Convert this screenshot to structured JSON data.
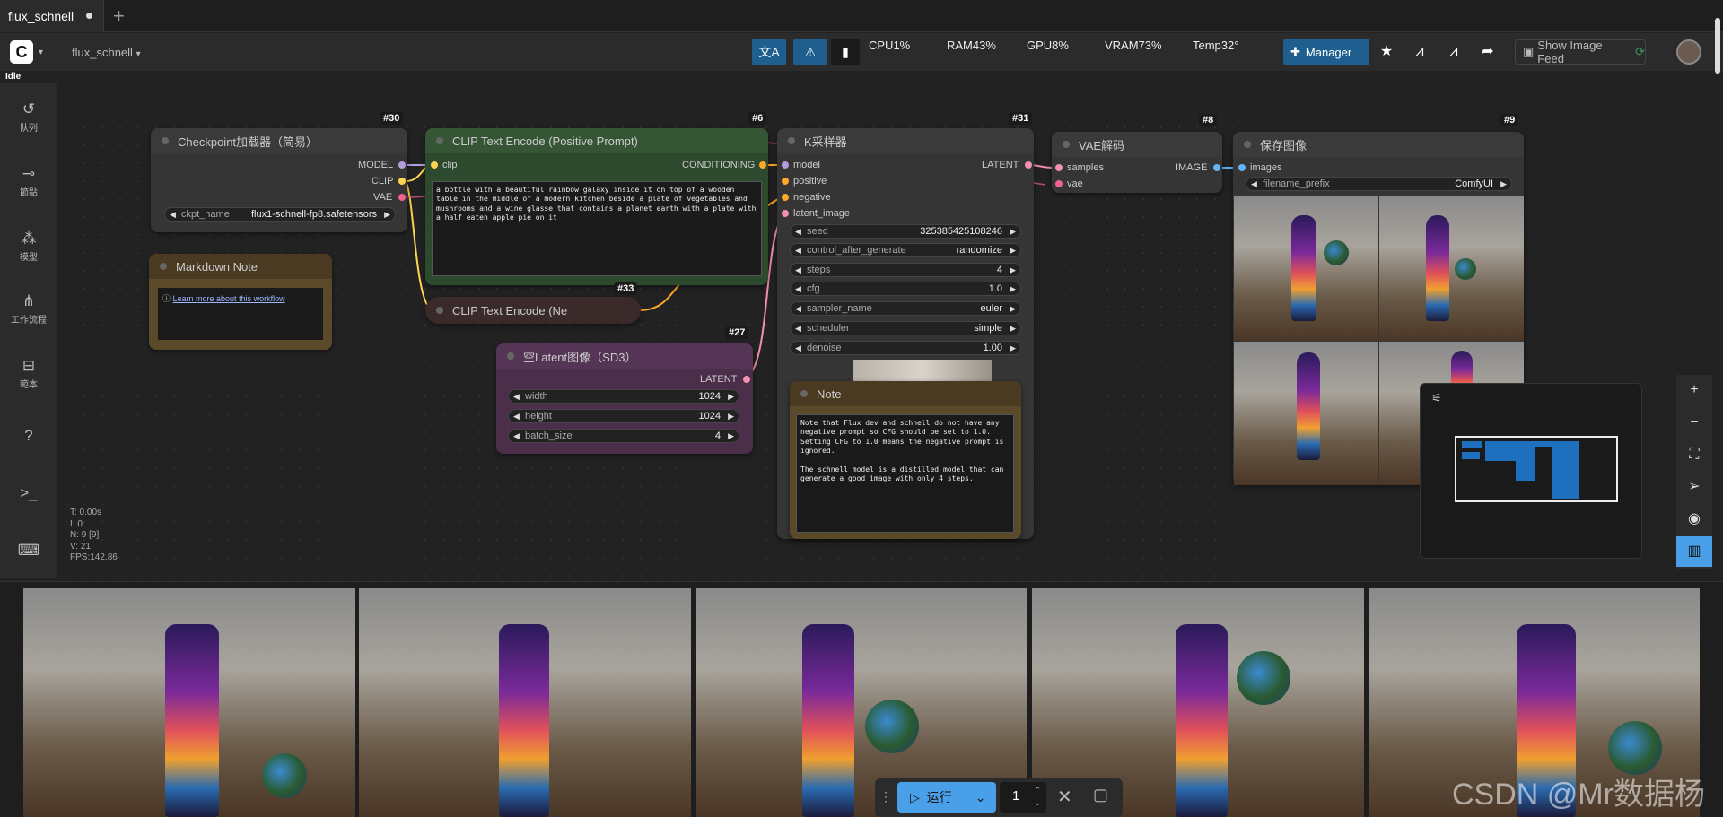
{
  "tab": {
    "title": "flux_schnell"
  },
  "header": {
    "workflow_name": "flux_schnell",
    "status": "Idle",
    "stats": {
      "cpu": "CPU1%",
      "ram": "RAM43%",
      "gpu": "GPU8%",
      "vram": "VRAM73%",
      "temp": "Temp32°"
    },
    "manager_label": "Manager",
    "feed_label": "Show Image Feed"
  },
  "sidebar": {
    "items": [
      {
        "label": "队列",
        "icon": "history-icon"
      },
      {
        "label": "節點",
        "icon": "node-icon"
      },
      {
        "label": "模型",
        "icon": "model-icon"
      },
      {
        "label": "工作流程",
        "icon": "workflow-icon"
      },
      {
        "label": "範本",
        "icon": "template-icon"
      },
      {
        "label": "",
        "icon": "help-icon"
      },
      {
        "label": "",
        "icon": "terminal-icon"
      },
      {
        "label": "",
        "icon": "keyboard-icon"
      }
    ]
  },
  "nodes": {
    "checkpoint": {
      "id": "#30",
      "title": "Checkpoint加载器（简易）",
      "outputs": [
        "MODEL",
        "CLIP",
        "VAE"
      ],
      "widget": {
        "name": "ckpt_name",
        "value": "flux1-schnell-fp8.safetensors"
      }
    },
    "markdown": {
      "title": "Markdown Note",
      "link": "Learn more about this workflow"
    },
    "clip_pos": {
      "id": "#6",
      "title": "CLIP Text Encode (Positive Prompt)",
      "input": "clip",
      "output": "CONDITIONING",
      "text": "a bottle with a beautiful rainbow galaxy inside it on top of a wooden table in the middle of a modern kitchen beside a plate of vegetables and mushrooms and a wine glasse that contains a planet earth with a plate with a half eaten apple pie on it"
    },
    "clip_neg": {
      "id": "#33",
      "title": "CLIP Text Encode (Ne"
    },
    "latent": {
      "id": "#27",
      "title": "空Latent图像（SD3）",
      "output": "LATENT",
      "widgets": [
        {
          "name": "width",
          "value": "1024"
        },
        {
          "name": "height",
          "value": "1024"
        },
        {
          "name": "batch_size",
          "value": "4"
        }
      ]
    },
    "ksampler": {
      "id": "#31",
      "title": "K采样器",
      "inputs": [
        "model",
        "positive",
        "negative",
        "latent_image"
      ],
      "output": "LATENT",
      "widgets": [
        {
          "name": "seed",
          "value": "325385425108246"
        },
        {
          "name": "control_after_generate",
          "value": "randomize"
        },
        {
          "name": "steps",
          "value": "4"
        },
        {
          "name": "cfg",
          "value": "1.0"
        },
        {
          "name": "sampler_name",
          "value": "euler"
        },
        {
          "name": "scheduler",
          "value": "simple"
        },
        {
          "name": "denoise",
          "value": "1.00"
        }
      ]
    },
    "note": {
      "title": "Note",
      "text": "Note that Flux dev and schnell do not have any negative prompt so CFG should be set to 1.0. Setting CFG to 1.0 means the negative prompt is ignored.\n\nThe schnell model is a distilled model that can generate a good image with only 4 steps."
    },
    "vae": {
      "id": "#8",
      "title": "VAE解码",
      "inputs": [
        "samples",
        "vae"
      ],
      "output": "IMAGE"
    },
    "save": {
      "id": "#9",
      "title": "保存图像",
      "input": "images",
      "widget": {
        "name": "filename_prefix",
        "value": "ComfyUI"
      }
    }
  },
  "canvas_stats": {
    "t": "T: 0.00s",
    "i": "I: 0",
    "n": "N: 9 [9]",
    "v": "V: 21",
    "fps": "FPS:142.86"
  },
  "runbar": {
    "run_label": "运行",
    "count": "1"
  },
  "watermark": "CSDN @Mr数据杨",
  "colors": {
    "accent": "#1f5f8f",
    "run": "#4aa0e8",
    "clip_node": "#2e4a2e",
    "latent_node": "#4a2e4a",
    "note_node": "#5a4a2a"
  }
}
